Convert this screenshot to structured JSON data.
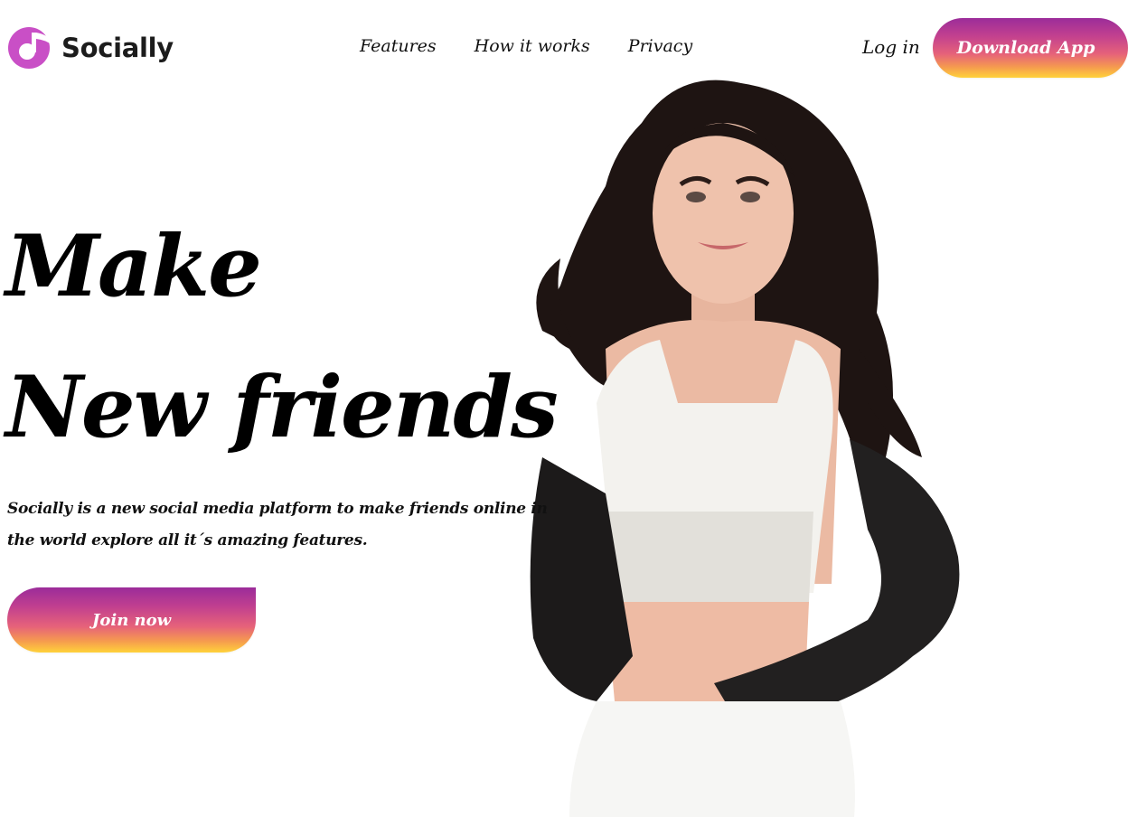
{
  "brand": {
    "name": "Socially",
    "logo_icon": "music-note-icon",
    "color": "#c94fc6"
  },
  "nav": {
    "items": [
      {
        "label": "Features"
      },
      {
        "label": "How it works"
      },
      {
        "label": "Privacy"
      }
    ],
    "login_label": "Log in",
    "download_label": "Download App"
  },
  "hero": {
    "title_line1": "Make",
    "title_line2": "New friends",
    "description": "Socially is a new social media platform to make friends online in the world explore all it´s amazing features.",
    "cta_label": "Join now",
    "image": "woman-portrait-image"
  },
  "colors": {
    "gradient_top": "#9b2c9a",
    "gradient_bottom": "#ffd23a"
  }
}
